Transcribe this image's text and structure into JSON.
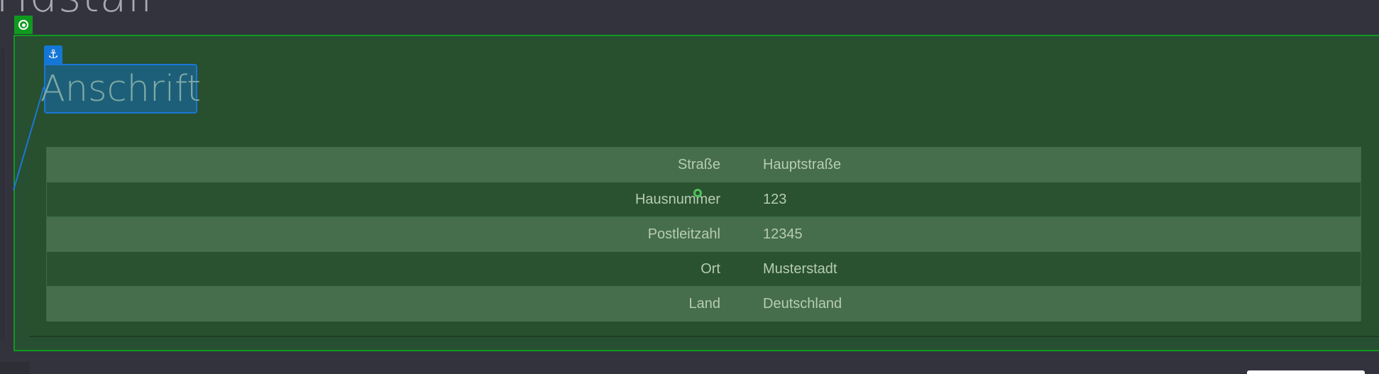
{
  "background_title": "Hdstall",
  "section": {
    "heading": "Anschrift"
  },
  "address_table": {
    "rows": [
      {
        "label": "Straße",
        "value": "Hauptstraße"
      },
      {
        "label": "Hausnummer",
        "value": "123"
      },
      {
        "label": "Postleitzahl",
        "value": "12345"
      },
      {
        "label": "Ort",
        "value": "Musterstadt"
      },
      {
        "label": "Land",
        "value": "Deutschland"
      }
    ]
  },
  "icons": {
    "select": "target-icon",
    "anchor": "anchor-icon",
    "anchor_glyph": "⚓"
  },
  "colors": {
    "page_bg": "#33333e",
    "selection": "#0f9a1f",
    "anchor_blue": "#1476d6",
    "card_bg": "#28502f",
    "row_light": "#466e4d",
    "row_dark": "#2a5231",
    "text": "#b7ccb3"
  }
}
